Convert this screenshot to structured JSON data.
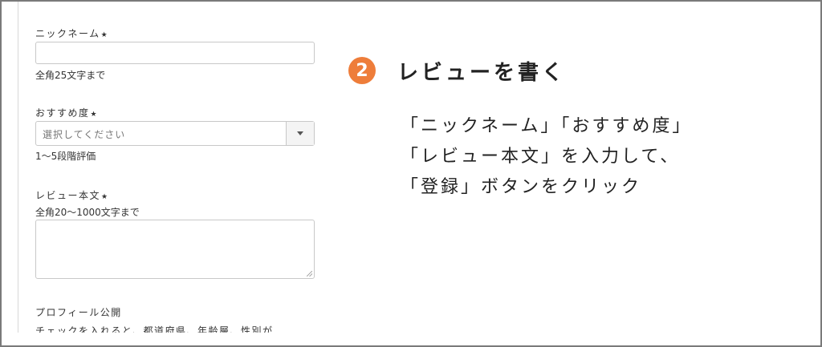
{
  "form": {
    "nickname": {
      "label": "ニックネーム",
      "required_mark": "★",
      "hint": "全角25文字まで",
      "value": ""
    },
    "rating": {
      "label": "おすすめ度",
      "required_mark": "★",
      "placeholder": "選択してください",
      "hint": "1〜5段階評価"
    },
    "review_body": {
      "label": "レビュー本文",
      "required_mark": "★",
      "hint": "全角20〜1000文字まで",
      "value": ""
    },
    "profile": {
      "label": "プロフィール公開",
      "partial_text": "チェックを入れると、都道府県、年齢層、性別が"
    }
  },
  "instruction": {
    "step_number": "2",
    "step_title": "レビューを書く",
    "lines": [
      "「ニックネーム」「おすすめ度」",
      "「レビュー本文」を入力して、",
      "「登録」ボタンをクリック"
    ],
    "badge_color": "#ee7d3a"
  }
}
